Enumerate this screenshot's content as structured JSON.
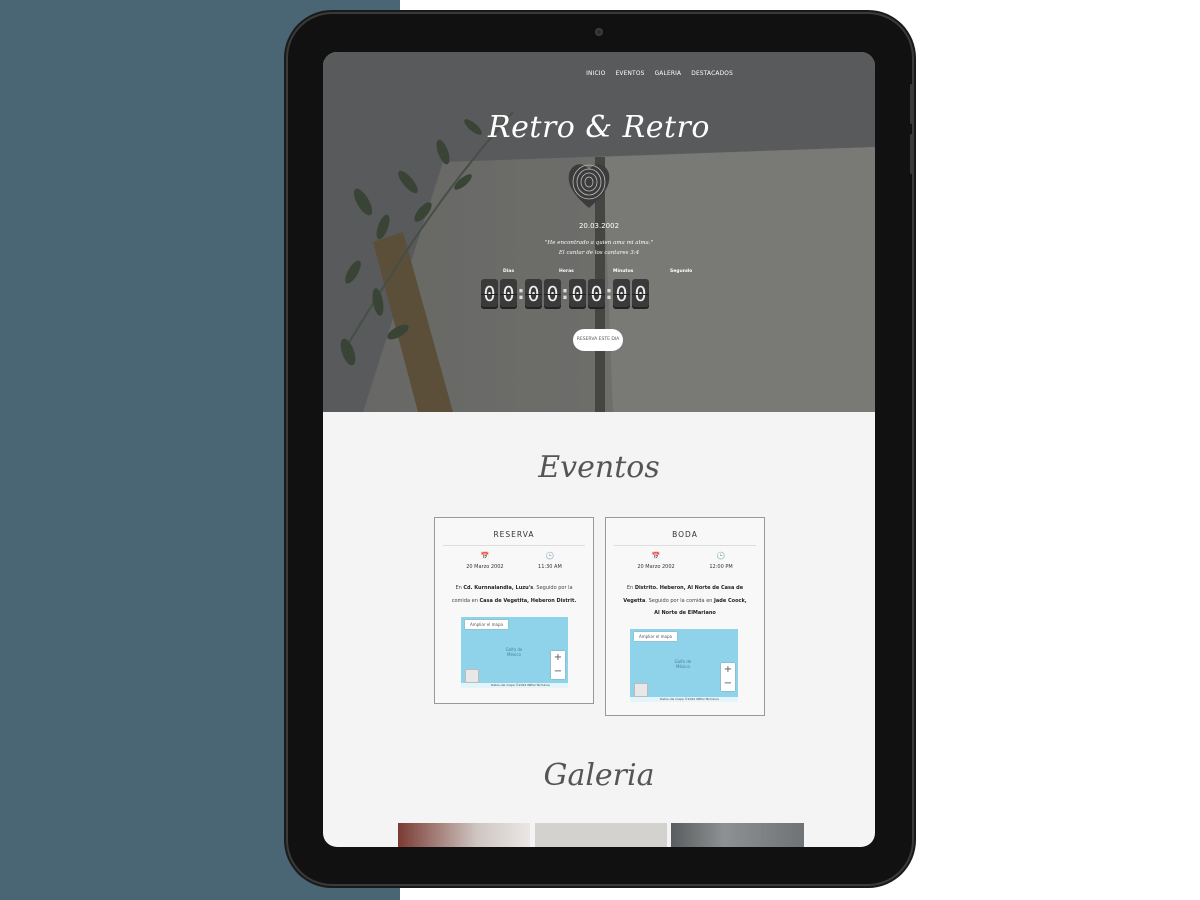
{
  "nav": {
    "items": [
      "INICIO",
      "EVENTOS",
      "GALERIA",
      "DESTACADOS"
    ]
  },
  "hero": {
    "title": "Retro & Retro",
    "date": "20.03.2002",
    "quote": "\"He encontrado a quien ama mi alma.\"",
    "quote_ref": "El cantar de los cantares 3:4",
    "countdown": {
      "labels": [
        "Dias",
        "Horas",
        "Minutos",
        "Segundo"
      ],
      "days": [
        "0",
        "0"
      ],
      "hours": [
        "0",
        "0"
      ],
      "minutes": [
        "0",
        "0"
      ],
      "seconds": [
        "0",
        "0"
      ]
    },
    "reserve_label": "RESERVA ESTE DIA"
  },
  "events": {
    "title": "Eventos",
    "cards": [
      {
        "title": "RESERVA",
        "date": "20 Marzo 2002",
        "time": "11:30 AM",
        "desc_prefix": "En ",
        "desc_place": "Cd. Kurnnalandia, Luzu's",
        "desc_mid": ". Seguido por la comida en ",
        "desc_place2": "Casa de Vegetita, Heberon Distrit.",
        "desc_suffix": "",
        "map": {
          "bigger": "Ampliar el mapa",
          "ocean": "Golfo de México",
          "footer": "Datos del mapa ©2022 INEGI  Términos"
        }
      },
      {
        "title": "BODA",
        "date": "20 Marzo 2002",
        "time": "12:00 PM",
        "desc_prefix": "En ",
        "desc_place": "Distrito. Heberon, Al Norte de Casa de Vegetta",
        "desc_mid": ". Seguido por la comida en ",
        "desc_place2": "Jade Coock, Al Norte de ElMariano",
        "desc_suffix": "",
        "map": {
          "bigger": "Ampliar el mapa",
          "ocean": "Golfo de México",
          "footer": "Datos del mapa ©2022 INEGI  Términos"
        }
      }
    ]
  },
  "gallery": {
    "title": "Galeria"
  },
  "icons": {
    "calendar": "calendar-icon",
    "clock": "clock-icon",
    "fingerprint": "fingerprint-heart-icon"
  },
  "colors": {
    "hero_overlay": "#6e6e6c",
    "page_bg": "#f4f4f4",
    "map_water": "#8fd3ea",
    "left_panel": "#4a6573"
  }
}
